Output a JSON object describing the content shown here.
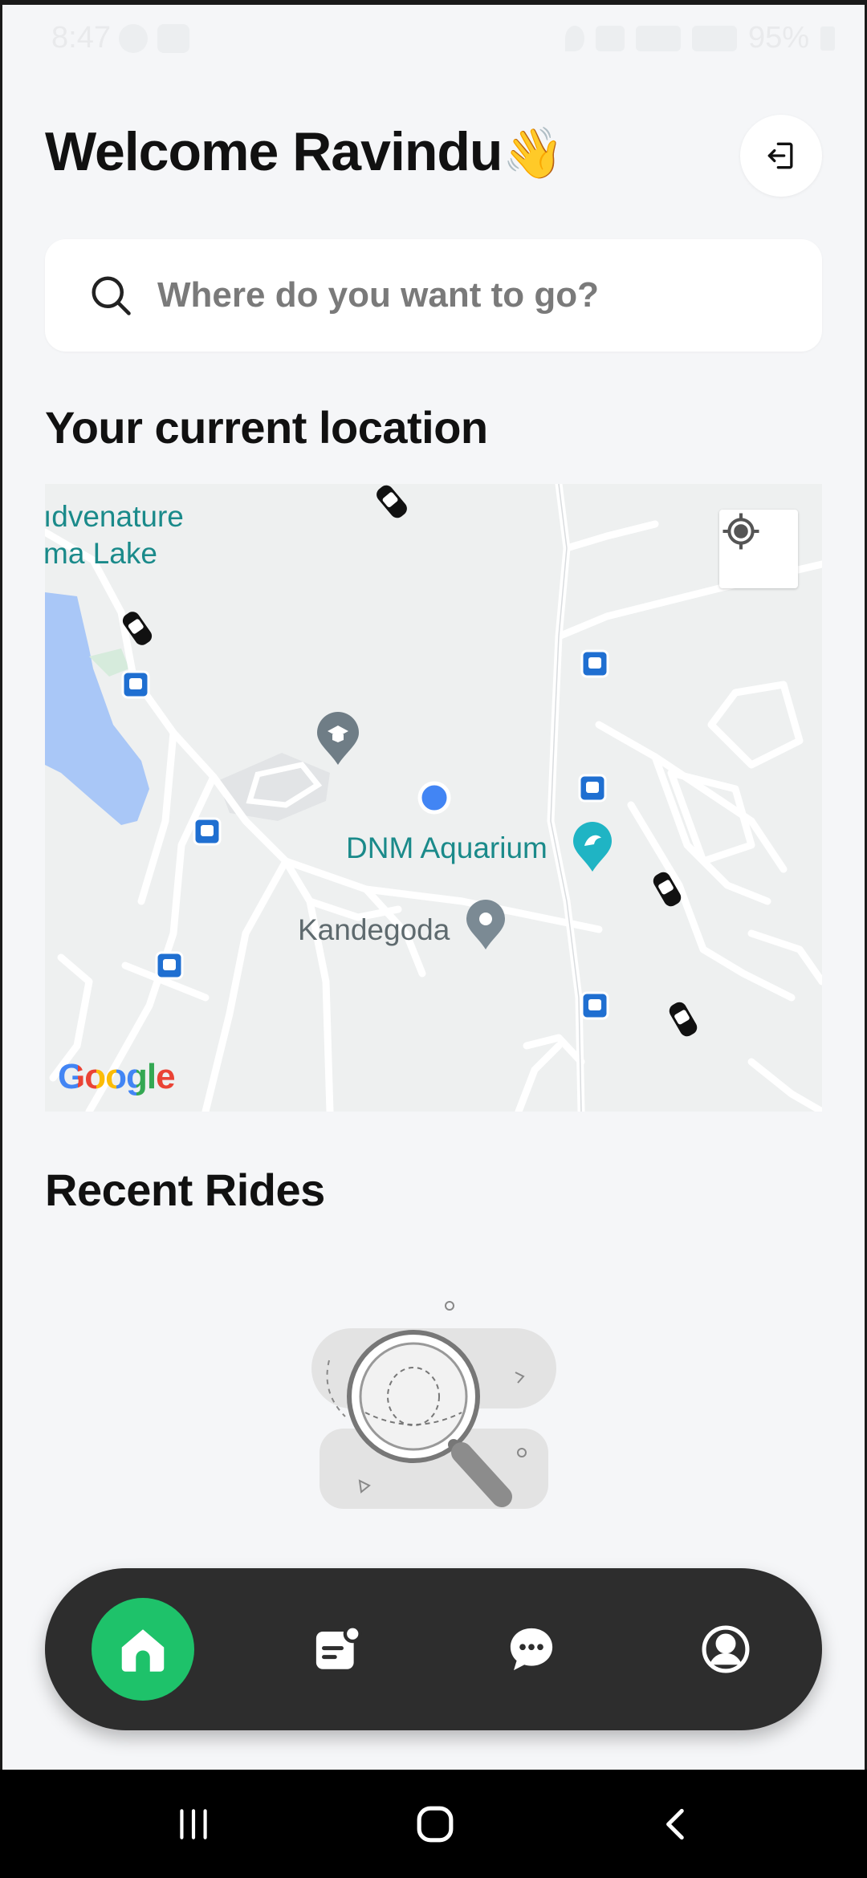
{
  "status_bar": {
    "time": "8:47",
    "battery": "95%"
  },
  "header": {
    "welcome": "Welcome Ravindu",
    "wave_emoji": "👋",
    "logout_icon": "logout-icon"
  },
  "search": {
    "placeholder": "Where do you want to go?",
    "icon": "search-icon"
  },
  "location_section": {
    "title": "Your current location"
  },
  "map": {
    "labels": {
      "adventure_line1": "ıdvenature",
      "adventure_line2": "ma Lake",
      "aquarium": "DNM Aquarium",
      "kandegoda": "Kandegoda"
    },
    "attribution": "Google",
    "colors": {
      "water": "#a9c7f7",
      "road": "#ffffff",
      "land": "#eef0f0",
      "label_teal": "#1a8a8a",
      "label_gray": "#5e6a6e",
      "bus_stop": "#1f6fd1",
      "user_dot": "#4285f4"
    }
  },
  "recent_rides": {
    "title": "Recent Rides"
  },
  "bottom_nav": {
    "items": [
      {
        "name": "home",
        "icon": "home-icon",
        "active": true
      },
      {
        "name": "rides",
        "icon": "rides-list-icon",
        "active": false
      },
      {
        "name": "chat",
        "icon": "chat-icon",
        "active": false
      },
      {
        "name": "profile",
        "icon": "profile-icon",
        "active": false
      }
    ],
    "accent": "#1ec26a",
    "bar_color": "#2d2d2d"
  },
  "system_nav": {
    "buttons": [
      "recent-apps-icon",
      "home-button-icon",
      "back-icon"
    ]
  }
}
